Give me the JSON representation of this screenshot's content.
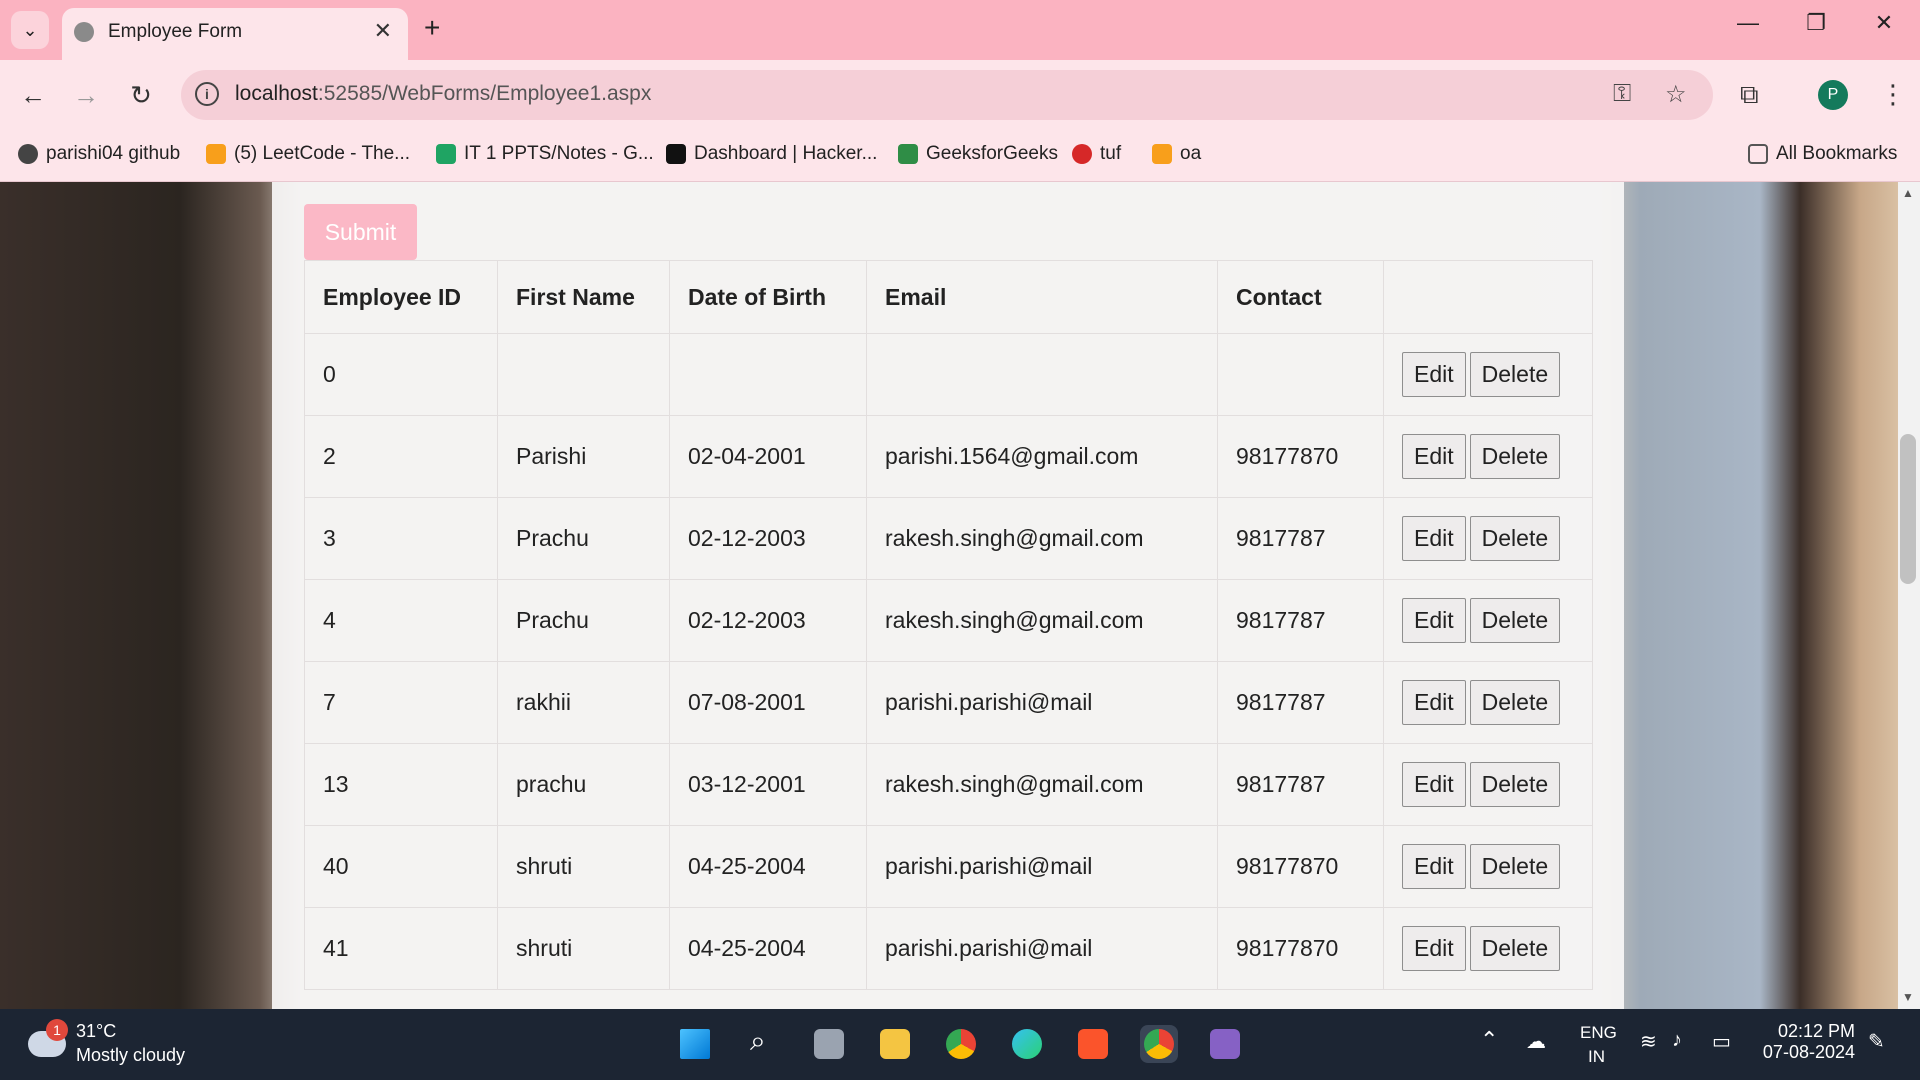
{
  "browser": {
    "tab_title": "Employee Form",
    "url_host": "localhost",
    "url_rest": ":52585/WebForms/Employee1.aspx",
    "bookmarks": [
      {
        "label": "parishi04 github",
        "icon": "github-icon",
        "color": "#444444"
      },
      {
        "label": "(5) LeetCode - The...",
        "icon": "leetcode-icon",
        "color": "#f89f1b"
      },
      {
        "label": "IT 1 PPTS/Notes - G...",
        "icon": "google-drive-icon",
        "color": "#1fa463"
      },
      {
        "label": "Dashboard | Hacker...",
        "icon": "hackerrank-icon",
        "color": "#111111"
      },
      {
        "label": "GeeksforGeeks",
        "icon": "gfg-icon",
        "color": "#2f8d46"
      },
      {
        "label": "tuf",
        "icon": "tuf-icon",
        "color": "#d62828"
      },
      {
        "label": "oa",
        "icon": "leetcode-icon",
        "color": "#f89f1b"
      }
    ],
    "all_bookmarks": "All Bookmarks",
    "profile_initial": "P"
  },
  "form": {
    "submit_label": "Submit"
  },
  "table": {
    "headers": [
      "Employee ID",
      "First Name",
      "Date of Birth",
      "Email",
      "Contact",
      ""
    ],
    "edit_label": "Edit",
    "delete_label": "Delete",
    "rows": [
      {
        "id": "0",
        "first_name": "",
        "dob": "",
        "email": "",
        "contact": ""
      },
      {
        "id": "2",
        "first_name": "Parishi",
        "dob": "02-04-2001",
        "email": "parishi.1564@gmail.com",
        "contact": "98177870"
      },
      {
        "id": "3",
        "first_name": "Prachu",
        "dob": "02-12-2003",
        "email": "rakesh.singh@gmail.com",
        "contact": "9817787"
      },
      {
        "id": "4",
        "first_name": "Prachu",
        "dob": "02-12-2003",
        "email": "rakesh.singh@gmail.com",
        "contact": "9817787"
      },
      {
        "id": "7",
        "first_name": "rakhii",
        "dob": "07-08-2001",
        "email": "parishi.parishi@mail",
        "contact": "9817787"
      },
      {
        "id": "13",
        "first_name": "prachu",
        "dob": "03-12-2001",
        "email": "rakesh.singh@gmail.com",
        "contact": "9817787"
      },
      {
        "id": "40",
        "first_name": "shruti",
        "dob": "04-25-2004",
        "email": "parishi.parishi@mail",
        "contact": "98177870"
      },
      {
        "id": "41",
        "first_name": "shruti",
        "dob": "04-25-2004",
        "email": "parishi.parishi@mail",
        "contact": "98177870"
      }
    ]
  },
  "taskbar": {
    "weather_badge": "1",
    "temperature": "31°C",
    "condition": "Mostly cloudy",
    "lang_top": "ENG",
    "lang_bottom": "IN",
    "time": "02:12 PM",
    "date": "07-08-2024"
  }
}
